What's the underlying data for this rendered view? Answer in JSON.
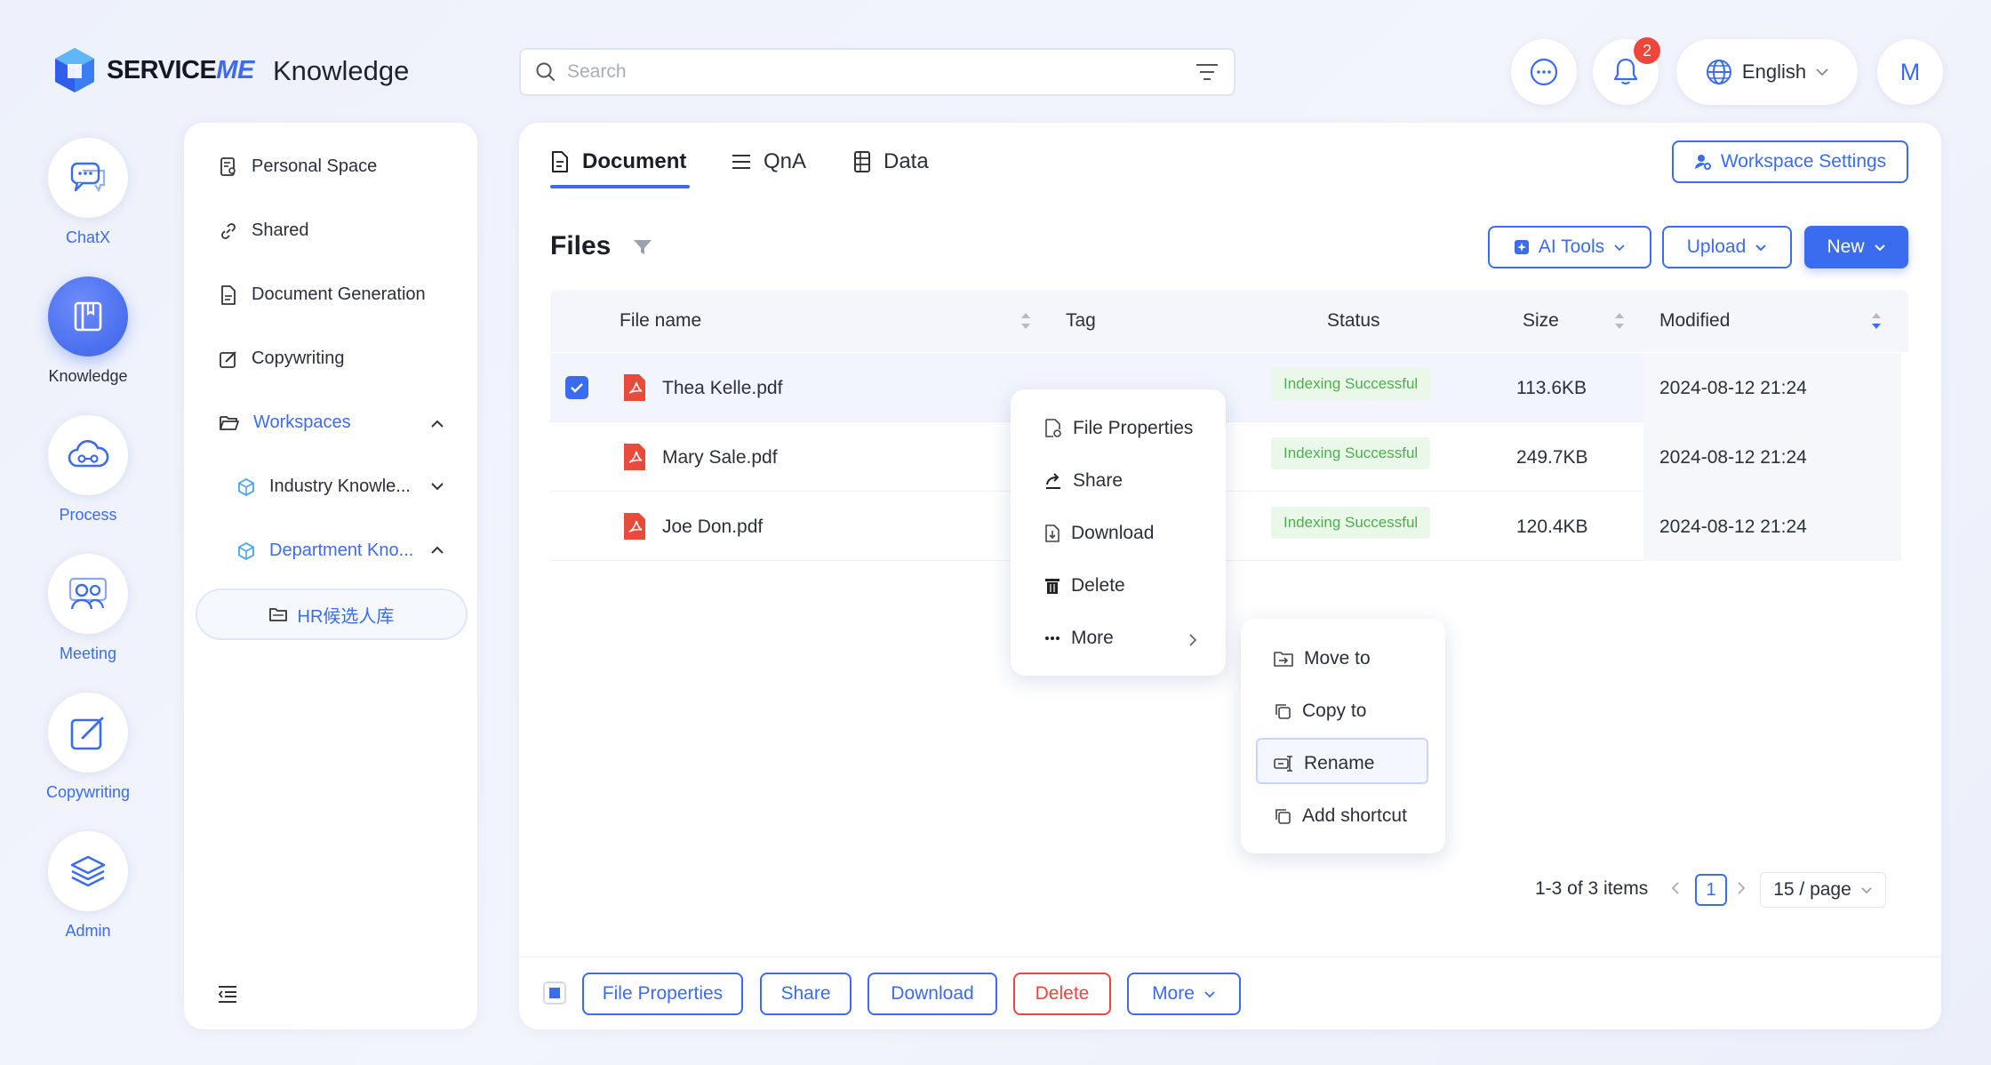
{
  "app": {
    "brand_prefix": "SERVICE",
    "brand_suffix": "ME",
    "title": "Knowledge"
  },
  "header": {
    "search_placeholder": "Search",
    "notification_count": "2",
    "language": "English",
    "avatar_initial": "M"
  },
  "rail": [
    {
      "label": "ChatX"
    },
    {
      "label": "Knowledge"
    },
    {
      "label": "Process"
    },
    {
      "label": "Meeting"
    },
    {
      "label": "Copywriting"
    },
    {
      "label": "Admin"
    }
  ],
  "nav": {
    "personal_space": "Personal Space",
    "shared": "Shared",
    "document_generation": "Document Generation",
    "copywriting": "Copywriting",
    "workspaces": "Workspaces",
    "industry_knowledge": "Industry Knowle...",
    "department_knowledge": "Department Kno...",
    "hr_folder": "HR候选人库"
  },
  "tabs": [
    {
      "label": "Document"
    },
    {
      "label": "QnA"
    },
    {
      "label": "Data"
    }
  ],
  "workspace_settings": "Workspace Settings",
  "files": {
    "title": "Files",
    "ai_tools": "AI Tools",
    "upload": "Upload",
    "new": "New",
    "columns": {
      "file_name": "File name",
      "tag": "Tag",
      "status": "Status",
      "size": "Size",
      "modified": "Modified"
    },
    "rows": [
      {
        "name": "Thea Kelle.pdf",
        "tag": "",
        "status": "Indexing Successful",
        "size": "113.6KB",
        "modified": "2024-08-12 21:24",
        "selected": true
      },
      {
        "name": "Mary Sale.pdf",
        "tag": "",
        "status": "Indexing Successful",
        "size": "249.7KB",
        "modified": "2024-08-12 21:24",
        "selected": false
      },
      {
        "name": "Joe Don.pdf",
        "tag": "",
        "status": "Indexing Successful",
        "size": "120.4KB",
        "modified": "2024-08-12 21:24",
        "selected": false
      }
    ]
  },
  "context_menu": {
    "file_properties": "File Properties",
    "share": "Share",
    "download": "Download",
    "delete": "Delete",
    "more": "More"
  },
  "submenu": {
    "move_to": "Move to",
    "copy_to": "Copy to",
    "rename": "Rename",
    "add_shortcut": "Add shortcut"
  },
  "pagination": {
    "summary": "1-3 of 3 items",
    "current_page": "1",
    "per_page": "15 / page"
  },
  "footer": {
    "file_properties": "File Properties",
    "share": "Share",
    "download": "Download",
    "delete": "Delete",
    "more": "More"
  },
  "colors": {
    "accent": "#3b6cf0",
    "danger": "#f0453c",
    "success_text": "#4cae4c",
    "success_bg": "#eaf8ea",
    "pdf_red": "#e84a3c"
  }
}
